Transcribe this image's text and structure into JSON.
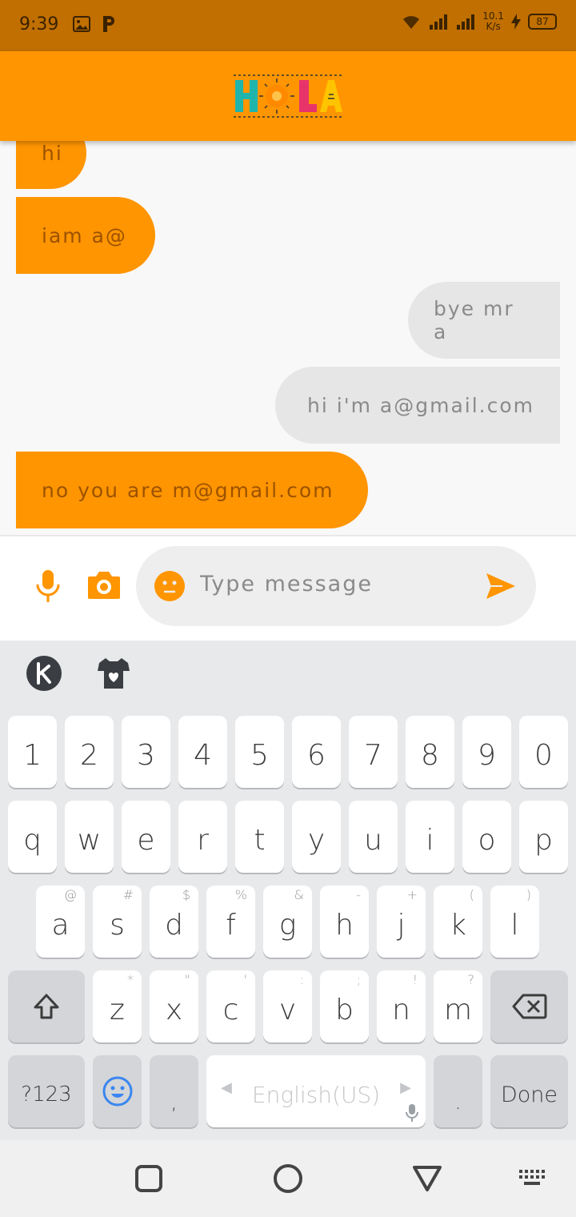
{
  "status_bar": {
    "time": "9:39",
    "net_speed_value": "10.1",
    "net_speed_unit": "K/s",
    "battery": "87"
  },
  "app_bar": {
    "logo": "HOLA"
  },
  "messages": [
    {
      "text": "hi",
      "direction": "incoming"
    },
    {
      "text": "iam a@",
      "direction": "incoming"
    },
    {
      "text": "bye mr a",
      "direction": "outgoing"
    },
    {
      "text": "hi i'm a@gmail.com",
      "direction": "outgoing"
    },
    {
      "text": "no you are m@gmail.com",
      "direction": "incoming"
    }
  ],
  "composer": {
    "placeholder": "Type message",
    "icons": [
      "microphone-icon",
      "camera-icon",
      "emoji-icon",
      "send-icon"
    ]
  },
  "keyboard": {
    "toolbar_icons": [
      "kika-logo-icon",
      "theme-shirt-icon"
    ],
    "row_numbers": [
      "1",
      "2",
      "3",
      "4",
      "5",
      "6",
      "7",
      "8",
      "9",
      "0"
    ],
    "row_qwerty": [
      "q",
      "w",
      "e",
      "r",
      "t",
      "y",
      "u",
      "i",
      "o",
      "p"
    ],
    "row_asdf": [
      "a",
      "s",
      "d",
      "f",
      "g",
      "h",
      "j",
      "k",
      "l"
    ],
    "row_asdf_hints": [
      "@",
      "#",
      "$",
      "%",
      "&",
      "-",
      "+",
      "(",
      ")"
    ],
    "row_zxcv": [
      "z",
      "x",
      "c",
      "v",
      "b",
      "n",
      "m"
    ],
    "row_zxcv_hints": [
      "*",
      "\"",
      "'",
      ":",
      ";",
      "!",
      "?"
    ],
    "symbols_label": "?123",
    "comma_label": ",",
    "space_label": "English(US)",
    "period_label": ".",
    "done_label": "Done"
  },
  "colors": {
    "accent": "#ff9500",
    "status_bar": "#c06f00",
    "incoming_bubble": "#ff9500",
    "outgoing_bubble": "#e6e6e6"
  }
}
